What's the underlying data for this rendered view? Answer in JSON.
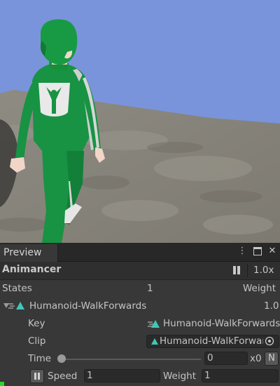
{
  "window": {
    "tab_label": "Preview",
    "menu_icon": "kebab-menu-icon",
    "maximize_icon": "maximize-icon",
    "close_icon": "close-icon"
  },
  "animancer": {
    "title": "Animancer",
    "speed": "1.0x"
  },
  "states": {
    "label": "States",
    "count": "1",
    "weight_label": "Weight"
  },
  "state": {
    "name": "Humanoid-WalkForwards",
    "weight": "1.0",
    "key_label": "Key",
    "key_value": "Humanoid-WalkForwards",
    "clip_label": "Clip",
    "clip_value": "Humanoid-WalkForwards",
    "time_label": "Time",
    "time_value": "0",
    "time_suffix": "x0",
    "time_normalize_button": "N",
    "speed_label": "Speed",
    "speed_value": "1",
    "weight_label": "Weight",
    "weight_value": "1"
  },
  "colors": {
    "sky": "#7a94db",
    "ground": "#8a877d",
    "tracksuit": "#179343",
    "panel": "#383838",
    "accent": "#3fc7b5"
  }
}
